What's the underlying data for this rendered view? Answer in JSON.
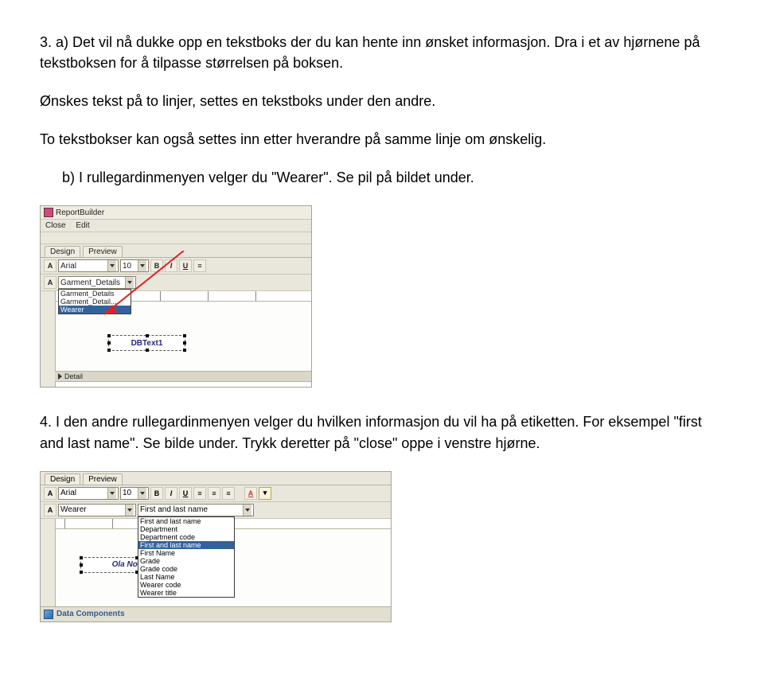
{
  "p1": "3. a) Det vil nå dukke opp en tekstboks der du kan hente inn ønsket informasjon. Dra i et av hjørnene på tekstboksen for å tilpasse størrelsen på boksen.",
  "p2": "Ønskes tekst på to linjer, settes en tekstboks under den andre.",
  "p3": "To tekstbokser kan også settes inn etter hverandre på samme linje om ønskelig.",
  "p4": "b) I rullegardinmenyen velger du \"Wearer\". Se pil på bildet under.",
  "p5": "4. I den andre rullegardinmenyen velger du hvilken informasjon du vil ha på etiketten. For eksempel \"first and last name\". Se bilde under. Trykk deretter på \"close\" oppe i venstre hjørne.",
  "shot1": {
    "title": "ReportBuilder",
    "menu_close": "Close",
    "menu_edit": "Edit",
    "tab_design": "Design",
    "tab_preview": "Preview",
    "font": "Arial",
    "size": "10",
    "dd_selected": "Garment_Details",
    "dd_opt1": "Garment_Details",
    "dd_opt2": "Garment_Detail...",
    "dd_opt3": "Wearer",
    "band_detail": "Detail",
    "textobj": "DBText1"
  },
  "shot2": {
    "tab_design": "Design",
    "tab_preview": "Preview",
    "font": "Arial",
    "size": "10",
    "dd_wearer": "Wearer",
    "dd2_selected": "First and last name",
    "opts": [
      "First and last name",
      "Department",
      "Department code",
      "First and last name",
      "First Name",
      "Grade",
      "Grade code",
      "Last Name",
      "Wearer code",
      "Wearer title"
    ],
    "sel_index": 3,
    "sample": "Ola Normann",
    "bottom": "Data Components"
  }
}
